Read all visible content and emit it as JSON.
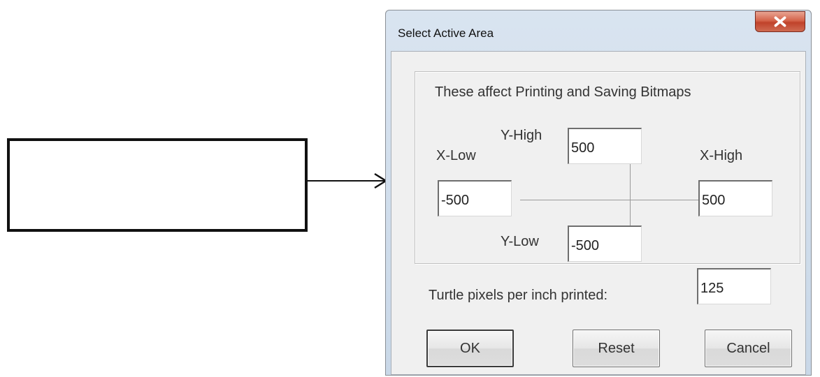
{
  "dialog": {
    "title": "Select Active Area",
    "group_caption": "These affect Printing and Saving Bitmaps",
    "y_high": {
      "label": "Y-High",
      "value": "500"
    },
    "x_low": {
      "label": "X-Low",
      "value": "-500"
    },
    "x_high": {
      "label": "X-High",
      "value": "500"
    },
    "y_low": {
      "label": "Y-Low",
      "value": "-500"
    },
    "pixels_per_inch": {
      "label": "Turtle pixels per inch printed:",
      "value": "125"
    },
    "buttons": {
      "ok": "OK",
      "reset": "Reset",
      "cancel": "Cancel"
    },
    "close_icon": "close-x-icon"
  },
  "annotation": {
    "box": "empty-rectangle",
    "arrow": "arrow-right"
  }
}
